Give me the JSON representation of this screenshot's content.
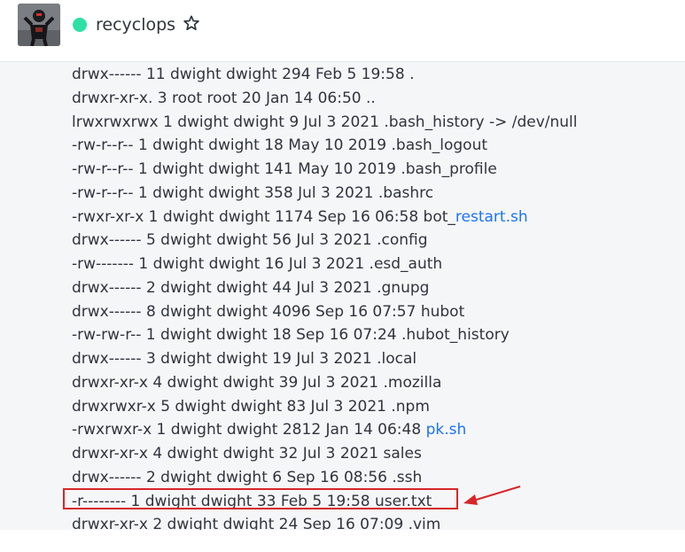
{
  "room": {
    "name": "recyclops",
    "status_color": "#2de0a5"
  },
  "icons": {
    "favorite": "star-outline-icon"
  },
  "listing": [
    {
      "prefix": "drwx------ 11 dwight dwight 294 Feb 5 19:58 .",
      "link": ""
    },
    {
      "prefix": "drwxr-xr-x. 3 root root 20 Jan 14 06:50 ..",
      "link": ""
    },
    {
      "prefix": "lrwxrwxrwx 1 dwight dwight 9 Jul 3 2021 .bash_history -> /dev/null",
      "link": ""
    },
    {
      "prefix": "-rw-r--r-- 1 dwight dwight 18 May 10 2019 .bash_logout",
      "link": ""
    },
    {
      "prefix": "-rw-r--r-- 1 dwight dwight 141 May 10 2019 .bash_profile",
      "link": ""
    },
    {
      "prefix": "-rw-r--r-- 1 dwight dwight 358 Jul 3 2021 .bashrc",
      "link": ""
    },
    {
      "prefix": "-rwxr-xr-x 1 dwight dwight 1174 Sep 16 06:58 bot_",
      "link": "restart.sh"
    },
    {
      "prefix": "drwx------ 5 dwight dwight 56 Jul 3 2021 .config",
      "link": ""
    },
    {
      "prefix": "-rw------- 1 dwight dwight 16 Jul 3 2021 .esd_auth",
      "link": ""
    },
    {
      "prefix": "drwx------ 2 dwight dwight 44 Jul 3 2021 .gnupg",
      "link": ""
    },
    {
      "prefix": "drwx------ 8 dwight dwight 4096 Sep 16 07:57 hubot",
      "link": ""
    },
    {
      "prefix": "-rw-rw-r-- 1 dwight dwight 18 Sep 16 07:24 .hubot_history",
      "link": ""
    },
    {
      "prefix": "drwx------ 3 dwight dwight 19 Jul 3 2021 .local",
      "link": ""
    },
    {
      "prefix": "drwxr-xr-x 4 dwight dwight 39 Jul 3 2021 .mozilla",
      "link": ""
    },
    {
      "prefix": "drwxrwxr-x 5 dwight dwight 83 Jul 3 2021 .npm",
      "link": ""
    },
    {
      "prefix": "-rwxrwxr-x 1 dwight dwight 2812 Jan 14 06:48 ",
      "link": "pk.sh"
    },
    {
      "prefix": "drwxr-xr-x 4 dwight dwight 32 Jul 3 2021 sales",
      "link": ""
    },
    {
      "prefix": "drwx------ 2 dwight dwight 6 Sep 16 08:56 .ssh",
      "link": ""
    },
    {
      "prefix": "-r-------- 1 dwight dwight 33 Feb 5 19:58 user.txt",
      "link": ""
    },
    {
      "prefix": "drwxr-xr-x 2 dwight dwight 24 Sep 16 07:09 .vim",
      "link": ""
    }
  ],
  "annotation": {
    "highlighted_line": "-r-------- 1 dwight dwight 33 Feb 5 19:58 user.txt",
    "color": "#d7262a"
  }
}
